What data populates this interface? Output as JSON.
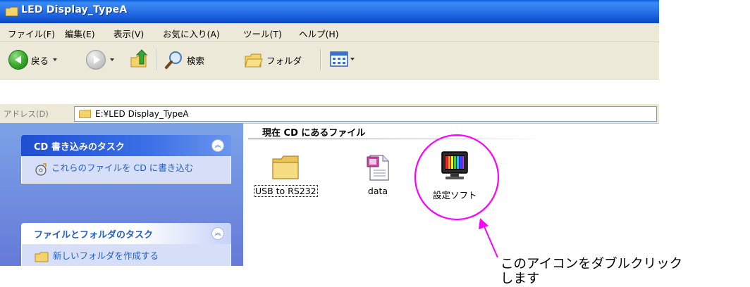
{
  "window": {
    "title": "LED Display_TypeA"
  },
  "menu": [
    "ファイル(F)",
    "編集(E)",
    "表示(V)",
    "お気に入り(A)",
    "ツール(T)",
    "ヘルプ(H)"
  ],
  "toolbar": {
    "back_label": "戻る",
    "search_label": "検索",
    "folders_label": "フォルダ"
  },
  "address": {
    "label": "アドレス(D)",
    "value": "E:¥LED Display_TypeA"
  },
  "tasks": {
    "cd_group_title": "CD 書き込みのタスク",
    "cd_task": "これらのファイルを CD に書き込む",
    "file_group_title": "ファイルとフォルダのタスク",
    "file_task": "新しいフォルダを作成する"
  },
  "files": {
    "section_title": "現在 CD にあるファイル",
    "items": [
      {
        "name": "USB to RS232",
        "icon": "folder-icon"
      },
      {
        "name": "data",
        "icon": "document-icon"
      },
      {
        "name": "設定ソフト",
        "icon": "monitor-app-icon"
      }
    ]
  },
  "annotation": {
    "line1": "このアイコンをダブルクリック",
    "line2": "します",
    "highlight_color": "#ff00ff"
  },
  "colors": {
    "titlebar": "#0d47c0",
    "taskpane": "#7ba2e7",
    "link": "#215dc6"
  }
}
